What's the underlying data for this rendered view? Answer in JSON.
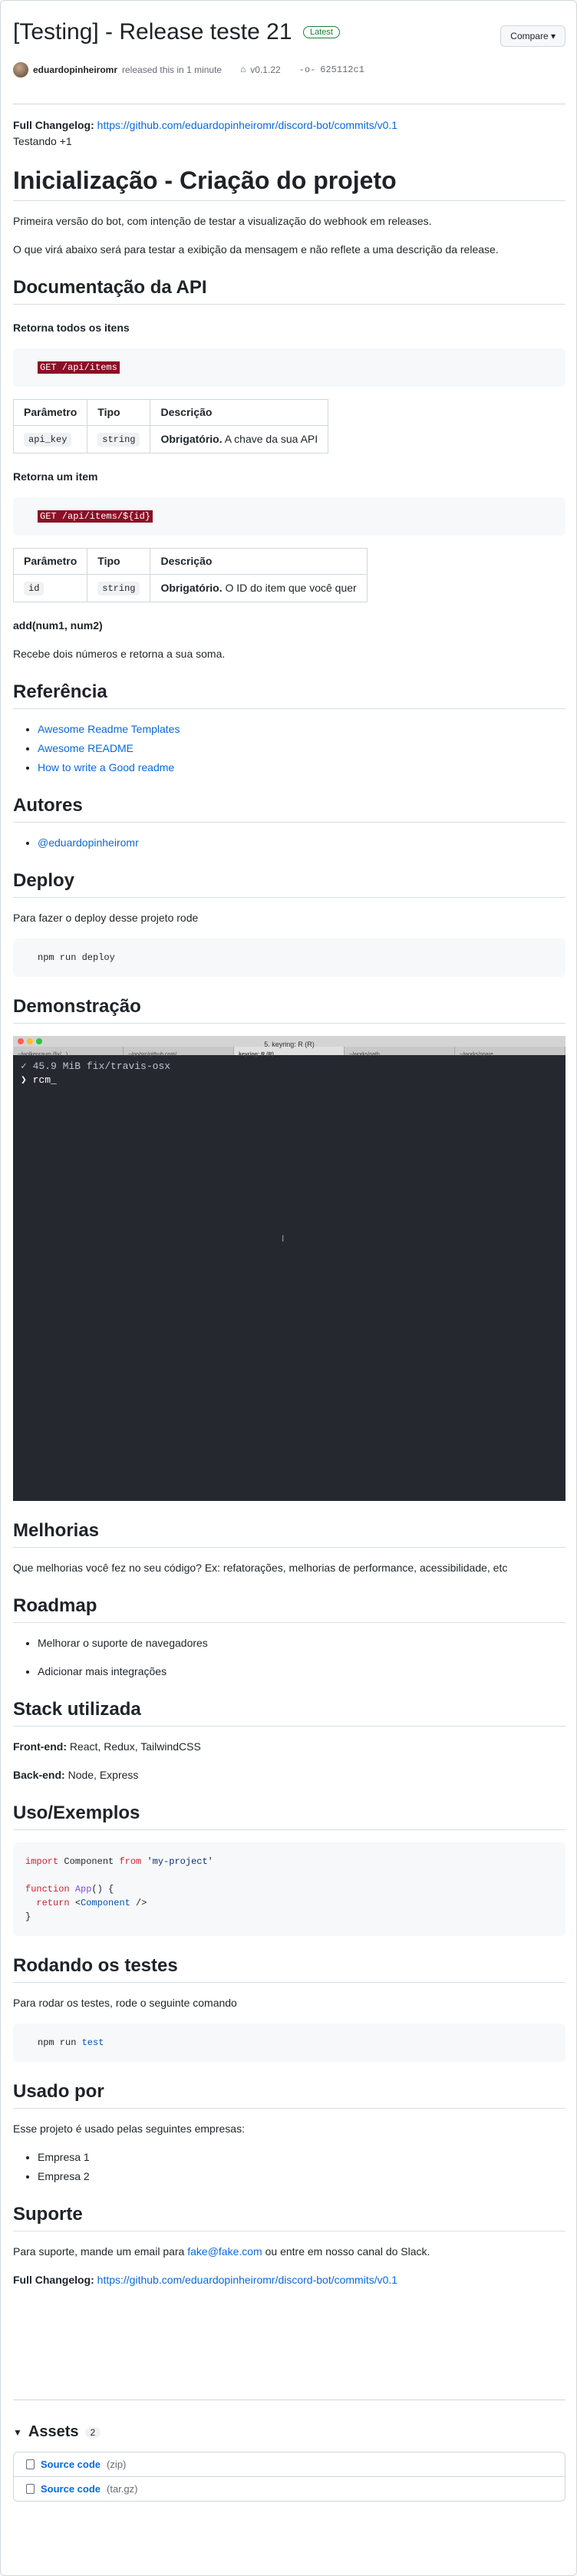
{
  "release": {
    "title": "[Testing] - Release teste 21",
    "latest": "Latest",
    "compare": "Compare ▾",
    "author": "eduardopinheiromr",
    "released": "released this in 1 minute",
    "tag": "v0.1.22",
    "commit": "625112c1"
  },
  "top": {
    "changelog_label": "Full Changelog:",
    "changelog_url": "https://github.com/eduardopinheiromr/discord-bot/commits/v0.1",
    "testing": "Testando +1"
  },
  "content": {
    "h1": "Inicialização - Criação do projeto",
    "p1": "Primeira versão do bot, com intenção de testar a visualização do webhook em releases.",
    "p2": "O que virá abaixo será para testar a exibição da mensagem e não reflete a uma descrição da release.",
    "api_title": "Documentação da API",
    "get_all_title": "Retorna todos os itens",
    "get_all_code": "GET /api/items",
    "table_headers": [
      "Parâmetro",
      "Tipo",
      "Descrição"
    ],
    "t1": {
      "param": "api_key",
      "type": "string",
      "req": "Obrigatório.",
      "desc": " A chave da sua API"
    },
    "get_one_title": "Retorna um item",
    "get_one_code": "GET /api/items/${id}",
    "t2": {
      "param": "id",
      "type": "string",
      "req": "Obrigatório.",
      "desc": " O ID do item que você quer"
    },
    "add_title": "add(num1, num2)",
    "add_desc": "Recebe dois números e retorna a sua soma.",
    "ref_title": "Referência",
    "refs": [
      "Awesome Readme Templates",
      "Awesome README",
      "How to write a Good readme"
    ],
    "authors_title": "Autores",
    "author_link": "@eduardopinheiromr",
    "deploy_title": "Deploy",
    "deploy_text": "Para fazer o deploy desse projeto rode",
    "deploy_code": "npm run deploy",
    "demo_title": "Demonstração",
    "demo_window": "5. keyring: R (R)",
    "demo_tabs": [
      "~/wolkenraum (fix/...)",
      "~/go/src/github.com/...",
      "keyring: R (R)",
      "~/works/path",
      "~/works/spare"
    ],
    "demo_line1": "✓ 45.9 MiB fix/travis-osx",
    "demo_line2": "❯ rcm_",
    "improve_title": "Melhorias",
    "improve_text": "Que melhorias você fez no seu código? Ex: refatorações, melhorias de performance, acessibilidade, etc",
    "roadmap_title": "Roadmap",
    "roadmap": [
      "Melhorar o suporte de navegadores",
      "Adicionar mais integrações"
    ],
    "stack_title": "Stack utilizada",
    "front_label": "Front-end:",
    "front": " React, Redux, TailwindCSS",
    "back_label": "Back-end:",
    "back": " Node, Express",
    "usage_title": "Uso/Exemplos",
    "tests_title": "Rodando os testes",
    "tests_text": "Para rodar os testes, rode o seguinte comando",
    "test_cmd": "npm run ",
    "test_kw": "test",
    "used_title": "Usado por",
    "used_text": "Esse projeto é usado pelas seguintes empresas:",
    "companies": [
      "Empresa 1",
      "Empresa 2"
    ],
    "support_title": "Suporte",
    "support_pre": "Para suporte, mande um email para ",
    "support_email": "fake@fake.com",
    "support_post": " ou entre em nosso canal do Slack.",
    "changelog_label": "Full Changelog:",
    "changelog_url": "https://github.com/eduardopinheiromr/discord-bot/commits/v0.1"
  },
  "assets": {
    "title": "Assets",
    "count": "2",
    "items": [
      {
        "name": "Source code",
        "ext": "(zip)"
      },
      {
        "name": "Source code",
        "ext": "(tar.gz)"
      }
    ]
  }
}
